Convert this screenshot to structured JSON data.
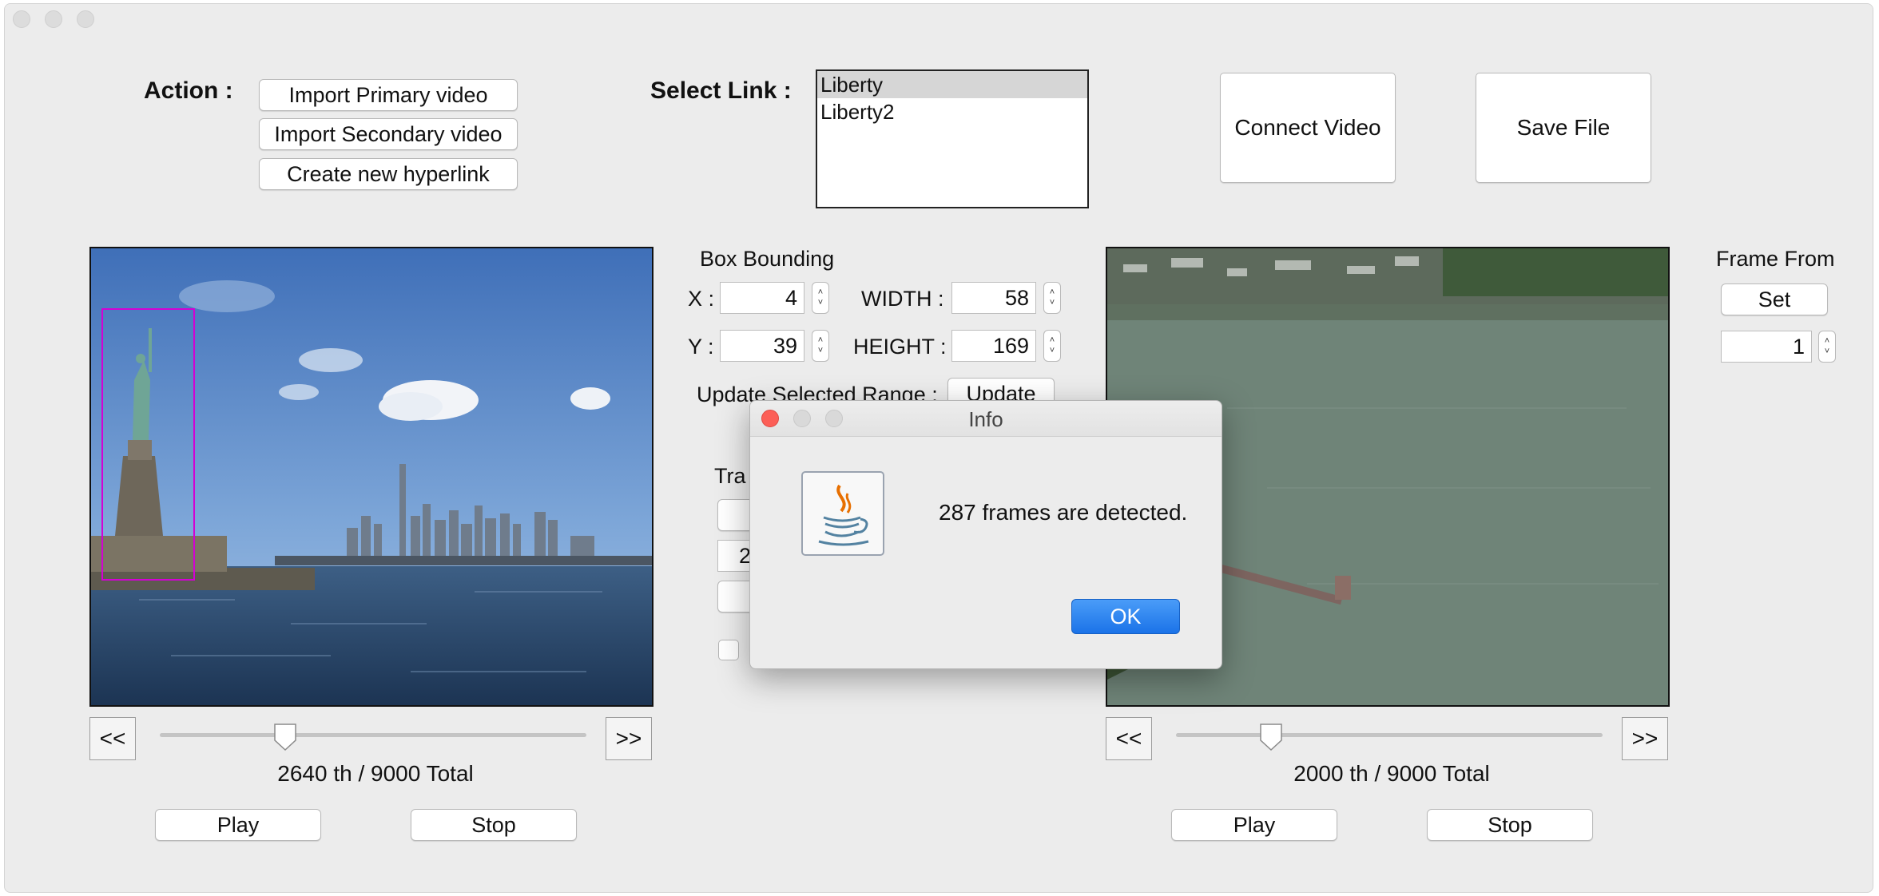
{
  "action": {
    "label": "Action :",
    "import_primary": "Import Primary video",
    "import_secondary": "Import Secondary video",
    "create_hyperlink": "Create new hyperlink"
  },
  "select_link": {
    "label": "Select Link :",
    "items": [
      "Liberty",
      "Liberty2"
    ],
    "selected": "Liberty"
  },
  "buttons": {
    "connect": "Connect Video",
    "save": "Save File"
  },
  "box_bounding": {
    "title": "Box Bounding",
    "x_label": "X :",
    "x": "4",
    "y_label": "Y :",
    "y": "39",
    "width_label": "WIDTH :",
    "width": "58",
    "height_label": "HEIGHT :",
    "height": "169",
    "update_label": "Update Selected Range :",
    "update_button": "Update",
    "tracking_partial": "Tra",
    "partial_value": "2"
  },
  "frame_from": {
    "title": "Frame From",
    "set_button": "Set",
    "value": "1"
  },
  "primary": {
    "prev": "<<",
    "next": ">>",
    "counter": "2640 th  /  9000 Total",
    "current": 2640,
    "total": 9000,
    "play": "Play",
    "stop": "Stop"
  },
  "secondary": {
    "prev": "<<",
    "next": ">>",
    "counter": "2000 th  /  9000 Total",
    "current": 2000,
    "total": 9000,
    "play": "Play",
    "stop": "Stop"
  },
  "dialog": {
    "title": "Info",
    "message": "287 frames are detected.",
    "ok": "OK",
    "icon": "java-coffee-cup-icon"
  },
  "colors": {
    "bounding_box": "#d400d4",
    "ok_button": "#1b73e8"
  }
}
